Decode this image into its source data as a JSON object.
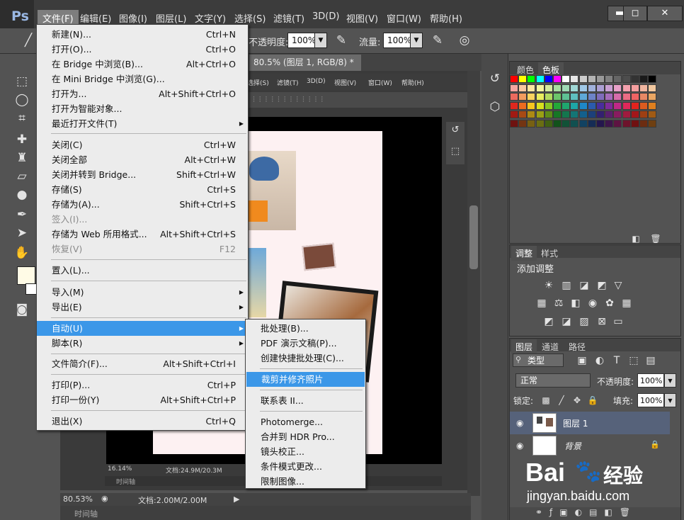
{
  "app": {
    "logo": "Ps"
  },
  "menubar": {
    "items": [
      "文件(F)",
      "编辑(E)",
      "图像(I)",
      "图层(L)",
      "文字(Y)",
      "选择(S)",
      "滤镜(T)",
      "3D(D)",
      "视图(V)",
      "窗口(W)",
      "帮助(H)"
    ]
  },
  "window_controls": {
    "minimize": "▬",
    "maximize": "◻",
    "close": "✕"
  },
  "options": {
    "opacity_label": "不透明度:",
    "opacity_value": "100%",
    "flow_label": "流量:",
    "flow_value": "100%"
  },
  "doc_tab": {
    "title": "80.5% (图层 1, RGB/8) *",
    "close": "×"
  },
  "inner_menu": [
    "选择(S)",
    "滤镜(T)",
    "3D(D)",
    "视图(V)",
    "窗口(W)",
    "帮助(H)"
  ],
  "file_menu": {
    "items": [
      {
        "label": "新建(N)...",
        "shortcut": "Ctrl+N"
      },
      {
        "label": "打开(O)...",
        "shortcut": "Ctrl+O"
      },
      {
        "label": "在 Bridge 中浏览(B)...",
        "shortcut": "Alt+Ctrl+O"
      },
      {
        "label": "在 Mini Bridge 中浏览(G)...",
        "shortcut": ""
      },
      {
        "label": "打开为...",
        "shortcut": "Alt+Shift+Ctrl+O"
      },
      {
        "label": "打开为智能对象...",
        "shortcut": ""
      },
      {
        "label": "最近打开文件(T)",
        "shortcut": ""
      },
      {
        "label": "关闭(C)",
        "shortcut": "Ctrl+W"
      },
      {
        "label": "关闭全部",
        "shortcut": "Alt+Ctrl+W"
      },
      {
        "label": "关闭并转到 Bridge...",
        "shortcut": "Shift+Ctrl+W"
      },
      {
        "label": "存储(S)",
        "shortcut": "Ctrl+S"
      },
      {
        "label": "存储为(A)...",
        "shortcut": "Shift+Ctrl+S"
      },
      {
        "label": "签入(I)...",
        "shortcut": ""
      },
      {
        "label": "存储为 Web 所用格式...",
        "shortcut": "Alt+Shift+Ctrl+S"
      },
      {
        "label": "恢复(V)",
        "shortcut": "F12"
      },
      {
        "label": "置入(L)...",
        "shortcut": ""
      },
      {
        "label": "导入(M)",
        "shortcut": ""
      },
      {
        "label": "导出(E)",
        "shortcut": ""
      },
      {
        "label": "自动(U)",
        "shortcut": ""
      },
      {
        "label": "脚本(R)",
        "shortcut": ""
      },
      {
        "label": "文件简介(F)...",
        "shortcut": "Alt+Shift+Ctrl+I"
      },
      {
        "label": "打印(P)...",
        "shortcut": "Ctrl+P"
      },
      {
        "label": "打印一份(Y)",
        "shortcut": "Alt+Shift+Ctrl+P"
      },
      {
        "label": "退出(X)",
        "shortcut": "Ctrl+Q"
      }
    ]
  },
  "automate_menu": {
    "items": [
      "批处理(B)...",
      "PDF 演示文稿(P)...",
      "创建快捷批处理(C)...",
      "裁剪并修齐照片",
      "联系表 II...",
      "Photomerge...",
      "合并到 HDR Pro...",
      "镜头校正...",
      "条件模式更改...",
      "限制图像..."
    ]
  },
  "panels": {
    "swatch_tabs": [
      "颜色",
      "色板"
    ],
    "adjust_tabs": [
      "调整",
      "样式"
    ],
    "adjust_title": "添加调整",
    "layers_tabs": [
      "图层",
      "通道",
      "路径"
    ],
    "filter_kind": "类型",
    "blend_mode": "正常",
    "opacity_label": "不透明度:",
    "opacity_value": "100%",
    "lock_label": "锁定:",
    "fill_label": "填充:",
    "fill_value": "100%",
    "layers": [
      {
        "name": "图层 1"
      },
      {
        "name": "背景"
      }
    ]
  },
  "status": {
    "zoom_inner": "16.14%",
    "doc_inner": "文档:24.9M/20.3M",
    "timeline_inner": "时间轴",
    "zoom": "80.53%",
    "doc": "文档:2.00M/2.00M",
    "timeline": "时间轴"
  },
  "watermark": {
    "brand": "Bai",
    "brand2": "经验",
    "url": "jingyan.baidu.com"
  },
  "colors": {
    "highlight": "#3b97e8",
    "foreground": "#fffbe6",
    "background": "#ffffff"
  }
}
